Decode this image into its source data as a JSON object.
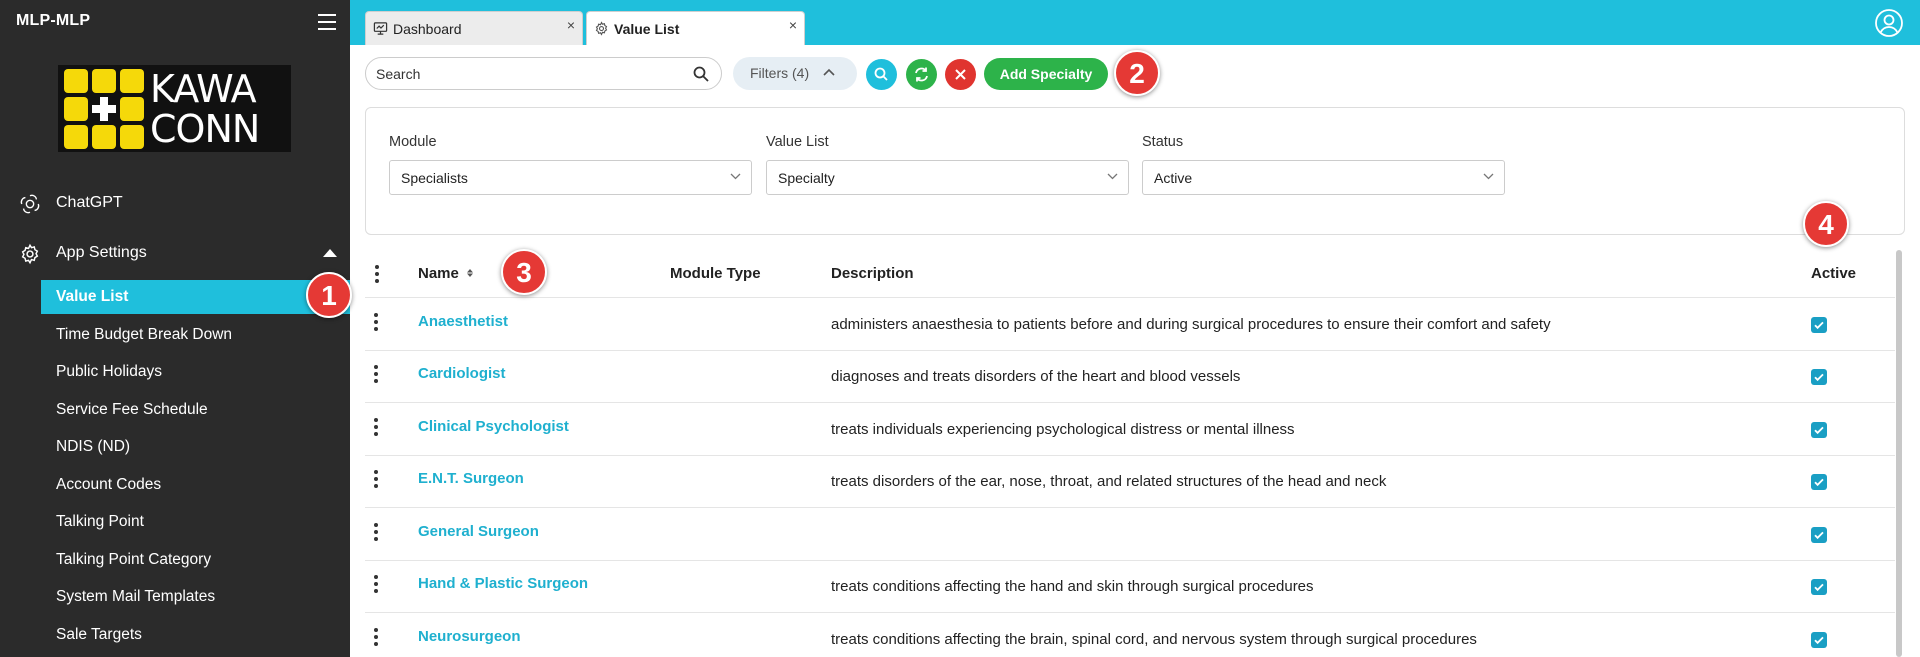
{
  "app": {
    "title": "MLP-MLP"
  },
  "logo": {
    "text_line1": "KAWA",
    "text_line2": "CONN"
  },
  "sidebar": {
    "chatgpt_label": "ChatGPT",
    "app_settings_label": "App Settings",
    "sub_items": [
      {
        "label": "Value List",
        "active": true
      },
      {
        "label": "Time Budget Break Down"
      },
      {
        "label": "Public Holidays"
      },
      {
        "label": "Service Fee Schedule"
      },
      {
        "label": "NDIS (ND)"
      },
      {
        "label": "Account Codes"
      },
      {
        "label": "Talking Point"
      },
      {
        "label": "Talking Point Category"
      },
      {
        "label": "System Mail Templates"
      },
      {
        "label": "Sale Targets"
      }
    ]
  },
  "tabs": [
    {
      "label": "Dashboard",
      "icon": "dashboard-icon",
      "close": "×"
    },
    {
      "label": "Value List",
      "icon": "gear-icon",
      "close": "×",
      "active": true
    }
  ],
  "toolbar": {
    "search_placeholder": "Search",
    "filters_label": "Filters (4)",
    "add_label": "Add Specialty"
  },
  "filters": {
    "module": {
      "label": "Module",
      "value": "Specialists"
    },
    "value_list": {
      "label": "Value List",
      "value": "Specialty"
    },
    "status": {
      "label": "Status",
      "value": "Active"
    }
  },
  "table": {
    "headers": {
      "name": "Name",
      "module_type": "Module Type",
      "description": "Description",
      "active": "Active"
    },
    "rows": [
      {
        "name": "Anaesthetist",
        "module_type": "",
        "description": "administers anaesthesia to patients before and during surgical procedures to ensure their comfort and safety",
        "active": true
      },
      {
        "name": "Cardiologist",
        "module_type": "",
        "description": "diagnoses and treats disorders of the heart and blood vessels",
        "active": true
      },
      {
        "name": "Clinical Psychologist",
        "module_type": "",
        "description": "treats individuals experiencing psychological distress or mental illness",
        "active": true
      },
      {
        "name": "E.N.T. Surgeon",
        "module_type": "",
        "description": "treats disorders of the ear, nose, throat, and related structures of the head and neck",
        "active": true
      },
      {
        "name": "General Surgeon",
        "module_type": "",
        "description": "",
        "active": true
      },
      {
        "name": "Hand & Plastic Surgeon",
        "module_type": "",
        "description": "treats conditions affecting the hand and skin through surgical procedures",
        "active": true
      },
      {
        "name": "Neurosurgeon",
        "module_type": "",
        "description": "treats conditions affecting the brain, spinal cord, and nervous system through surgical procedures",
        "active": true
      }
    ]
  },
  "annotations": [
    "1",
    "2",
    "3",
    "4"
  ],
  "colors": {
    "accent": "#1fbfdc",
    "sidebar": "#2b2b2b",
    "add_button": "#2db34a",
    "refresh_button": "#2db34a",
    "clear_button": "#e0342f",
    "badge": "#e53935",
    "link": "#1fb0cf"
  }
}
